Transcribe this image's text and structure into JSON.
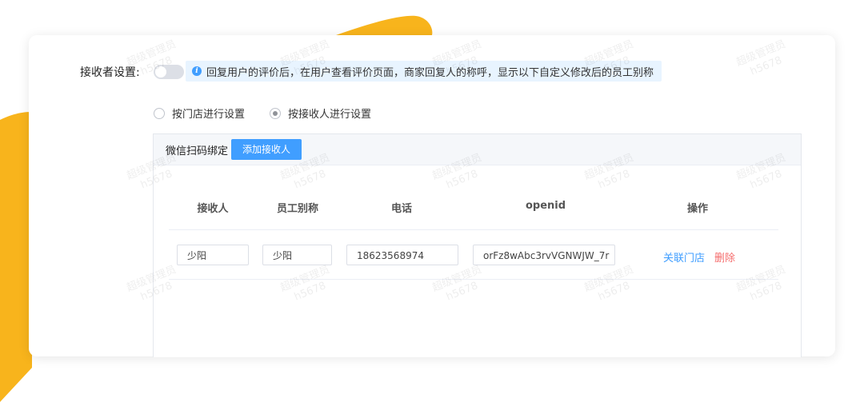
{
  "colors": {
    "accent": "#409eff",
    "danger": "#f56c6c",
    "brand_yellow": "#f8b41c"
  },
  "receiver_setting": {
    "label": "接收者设置:",
    "toggle_on": false,
    "hint_icon": "info-icon",
    "hint": "回复用户的评价后，在用户查看评价页面，商家回复人的称呼，显示以下自定义修改后的员工别称"
  },
  "radios": [
    {
      "label": "按门店进行设置",
      "checked": false
    },
    {
      "label": "按接收人进行设置",
      "checked": true
    }
  ],
  "panel": {
    "title": "微信扫码绑定",
    "add_button": "添加接收人"
  },
  "table": {
    "headers": [
      "接收人",
      "员工别称",
      "电话",
      "openid",
      "操作"
    ],
    "rows": [
      {
        "receiver": "少阳",
        "alias": "少阳",
        "phone": "18623568974",
        "openid": "orFz8wAbc3rvVGNWJW_7r",
        "action_link": "关联门店",
        "action_delete": "删除"
      }
    ]
  },
  "watermark": {
    "line1": "超级管理员",
    "line2": "h5678"
  }
}
